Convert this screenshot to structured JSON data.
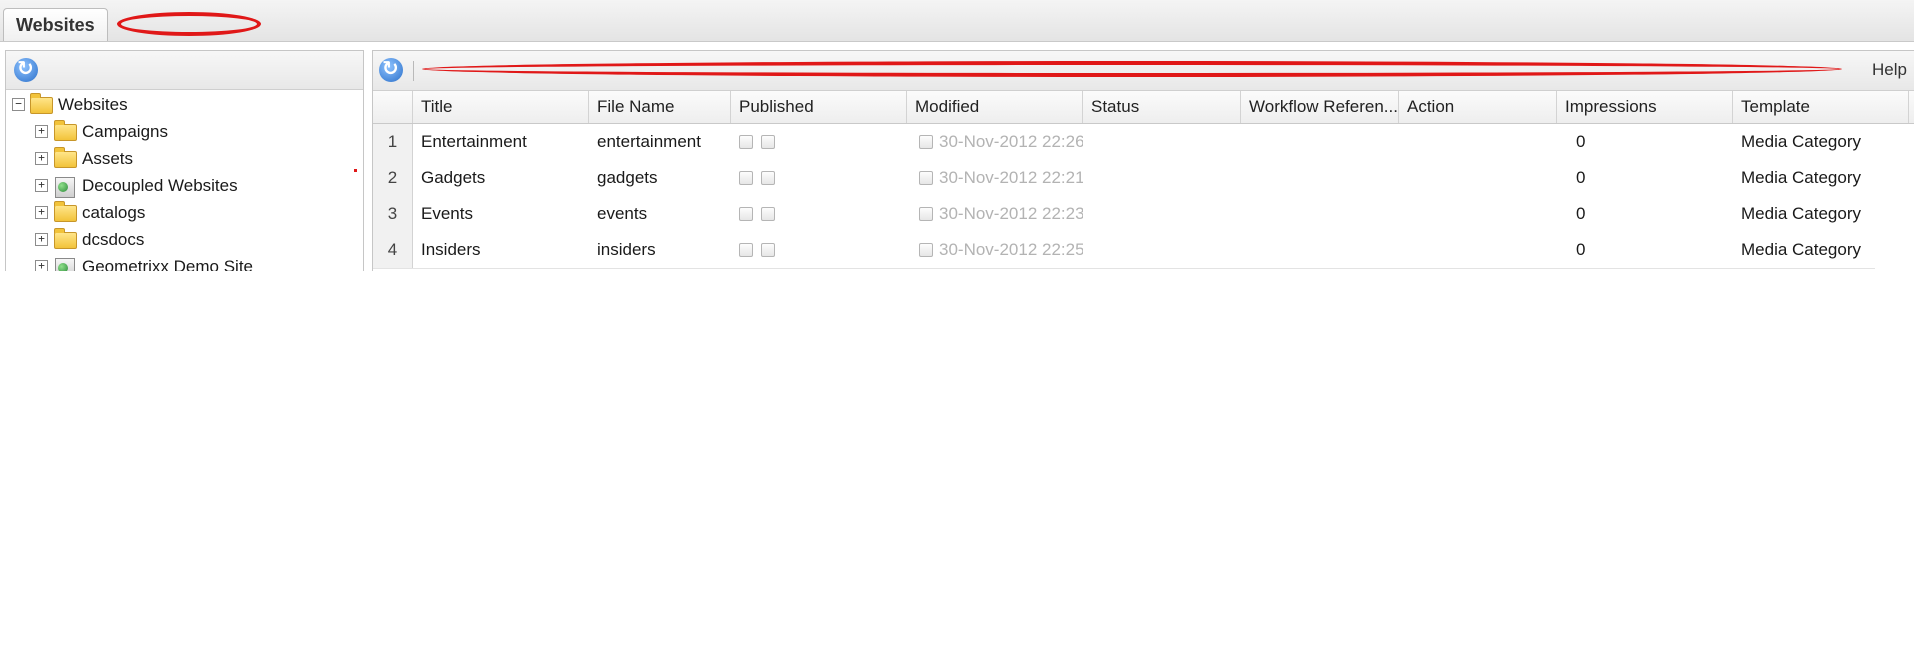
{
  "tabs": [
    {
      "label": "Websites",
      "active": true
    }
  ],
  "left_panel": {
    "tree": [
      {
        "label": "Websites",
        "icon": "folder-icon",
        "expander": "−",
        "level": 0
      },
      {
        "label": "Campaigns",
        "icon": "folder-icon",
        "expander": "+",
        "level": 1
      },
      {
        "label": "Assets",
        "icon": "folder-icon",
        "expander": "+",
        "level": 1
      },
      {
        "label": "Decoupled Websites",
        "icon": "site-icon",
        "expander": "+",
        "level": 1
      },
      {
        "label": "catalogs",
        "icon": "folder-icon",
        "expander": "+",
        "level": 1
      },
      {
        "label": "dcsdocs",
        "icon": "folder-icon",
        "expander": "+",
        "level": 1
      },
      {
        "label": "Geometrixx Demo Site",
        "icon": "site-icon",
        "expander": "+",
        "level": 1
      }
    ]
  },
  "grid": {
    "toolbar": {
      "help_label": "Help"
    },
    "columns": [
      "Title",
      "File Name",
      "Published",
      "Modified",
      "Status",
      "Workflow Referen...",
      "Action",
      "Impressions",
      "Template"
    ],
    "rows": [
      {
        "num": "1",
        "title": "Entertainment",
        "file_name": "entertainment",
        "modified": "30-Nov-2012 22:26",
        "impressions": "0",
        "template": "Media Category"
      },
      {
        "num": "2",
        "title": "Gadgets",
        "file_name": "gadgets",
        "modified": "30-Nov-2012 22:21",
        "impressions": "0",
        "template": "Media Category"
      },
      {
        "num": "3",
        "title": "Events",
        "file_name": "events",
        "modified": "30-Nov-2012 22:23",
        "impressions": "0",
        "template": "Media Category"
      },
      {
        "num": "4",
        "title": "Insiders",
        "file_name": "insiders",
        "modified": "30-Nov-2012 22:25",
        "impressions": "0",
        "template": "Media Category"
      }
    ]
  },
  "colors": {
    "annotation_red": "#e01818",
    "refresh_blue": "#2a6fc9"
  }
}
